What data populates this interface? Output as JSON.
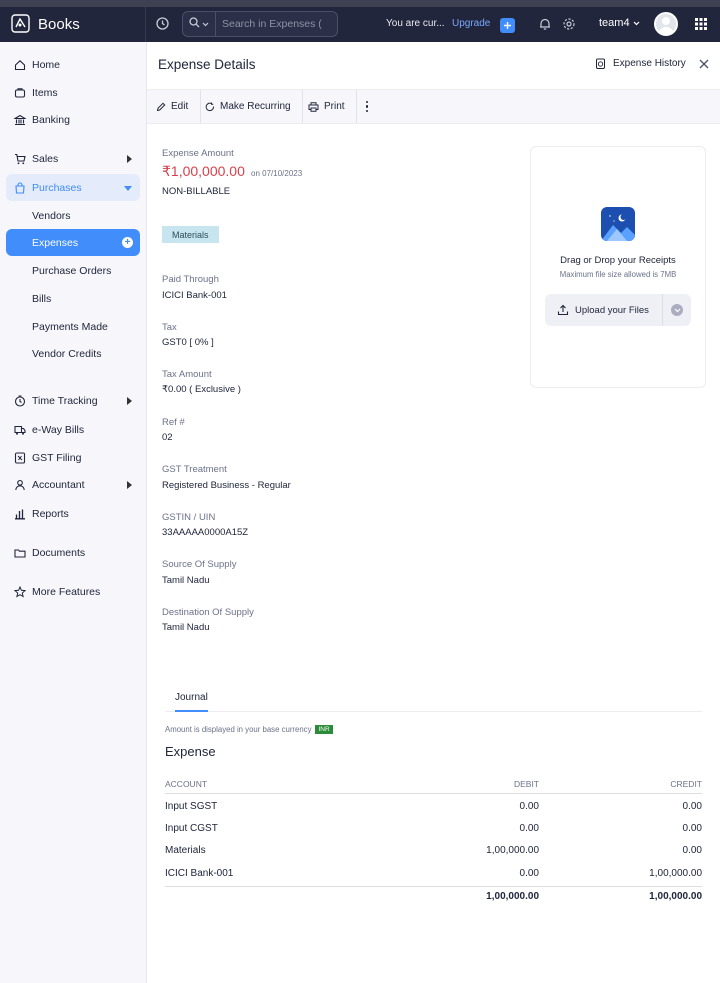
{
  "app": {
    "name": "Books"
  },
  "topbar": {
    "search_placeholder": "Search in Expenses (",
    "trial_text": "You are cur...",
    "upgrade_label": "Upgrade",
    "org_name": "team4"
  },
  "sidebar": {
    "home": "Home",
    "items": "Items",
    "banking": "Banking",
    "sales": "Sales",
    "purchases": "Purchases",
    "vendors": "Vendors",
    "expenses": "Expenses",
    "purchase_orders": "Purchase Orders",
    "bills": "Bills",
    "payments_made": "Payments Made",
    "vendor_credits": "Vendor Credits",
    "time_tracking": "Time Tracking",
    "eway_bills": "e-Way Bills",
    "gst_filing": "GST Filing",
    "accountant": "Accountant",
    "reports": "Reports",
    "documents": "Documents",
    "more_features": "More Features"
  },
  "detail": {
    "title": "Expense Details",
    "history_label": "Expense History",
    "toolbar": {
      "edit": "Edit",
      "make_recurring": "Make Recurring",
      "print": "Print"
    },
    "amount_label": "Expense Amount",
    "amount": "₹1,00,000.00",
    "amount_date": "on 07/10/2023",
    "billable": "NON-BILLABLE",
    "category_tag": "Materials",
    "fields": [
      {
        "label": "Paid Through",
        "value": "ICICI Bank-001"
      },
      {
        "label": "Tax",
        "value": "GST0 [ 0% ]"
      },
      {
        "label": "Tax Amount",
        "value": "₹0.00 ( Exclusive )"
      },
      {
        "label": "Ref #",
        "value": "02"
      },
      {
        "label": "GST Treatment",
        "value": "Registered Business - Regular"
      },
      {
        "label": "GSTIN / UIN",
        "value": "33AAAAA0000A15Z"
      },
      {
        "label": "Source Of Supply",
        "value": "Tamil Nadu"
      },
      {
        "label": "Destination Of Supply",
        "value": "Tamil Nadu"
      }
    ]
  },
  "receipt": {
    "title": "Drag or Drop your Receipts",
    "subtitle": "Maximum file size allowed is 7MB",
    "upload_label": "Upload your Files"
  },
  "journal": {
    "tab_label": "Journal",
    "currency_note": "Amount is displayed in your base currency",
    "currency_badge": "INR",
    "section_title": "Expense",
    "columns": {
      "account": "ACCOUNT",
      "debit": "DEBIT",
      "credit": "CREDIT"
    },
    "rows": [
      {
        "account": "Input SGST",
        "debit": "0.00",
        "credit": "0.00"
      },
      {
        "account": "Input CGST",
        "debit": "0.00",
        "credit": "0.00"
      },
      {
        "account": "Materials",
        "debit": "1,00,000.00",
        "credit": "0.00"
      },
      {
        "account": "ICICI Bank-001",
        "debit": "0.00",
        "credit": "1,00,000.00"
      }
    ],
    "total_debit": "1,00,000.00",
    "total_credit": "1,00,000.00"
  },
  "colors": {
    "accent": "#408dfb",
    "amount": "#d6424b",
    "topbar": "#21263c",
    "tag": "#c6e5ef"
  },
  "icons": {
    "home": "home-icon",
    "items": "items-icon",
    "banking": "bank-icon",
    "sales": "cart-icon",
    "purchases": "bag-icon",
    "time": "clock-icon",
    "eway": "truck-icon",
    "gst": "gst-icon",
    "accountant": "user-icon",
    "reports": "bar-chart-icon",
    "documents": "folder-icon",
    "more": "star-icon"
  }
}
